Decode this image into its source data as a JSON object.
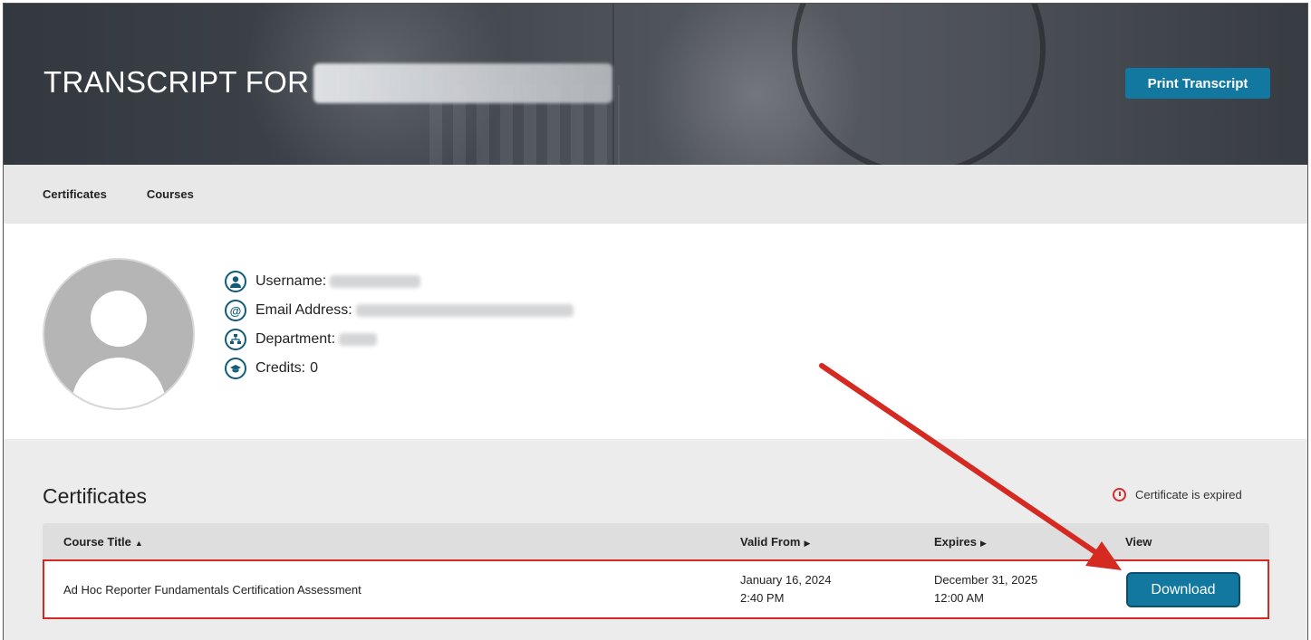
{
  "header": {
    "title": "TRANSCRIPT FOR",
    "print_label": "Print Transcript"
  },
  "tabs": [
    {
      "label": "Certificates"
    },
    {
      "label": "Courses"
    }
  ],
  "profile": {
    "fields": [
      {
        "label": "Username:",
        "icon": "user-icon"
      },
      {
        "label": "Email Address:",
        "icon": "at-icon"
      },
      {
        "label": "Department:",
        "icon": "org-chart-icon"
      },
      {
        "label": "Credits:",
        "value": "0",
        "icon": "graduation-cap-icon"
      }
    ]
  },
  "certificates": {
    "title": "Certificates",
    "legend": "Certificate is expired",
    "legend_icon": "stopwatch-icon",
    "columns": [
      "Course Title",
      "Valid From",
      "Expires",
      "View"
    ],
    "rows": [
      {
        "title": "Ad Hoc Reporter Fundamentals Certification Assessment",
        "valid_from_date": "January 16, 2024",
        "valid_from_time": "2:40 PM",
        "expires_date": "December 31, 2025",
        "expires_time": "12:00 AM",
        "action": "Download"
      }
    ]
  },
  "colors": {
    "accent": "#1278a0",
    "highlight": "#d42a22"
  }
}
